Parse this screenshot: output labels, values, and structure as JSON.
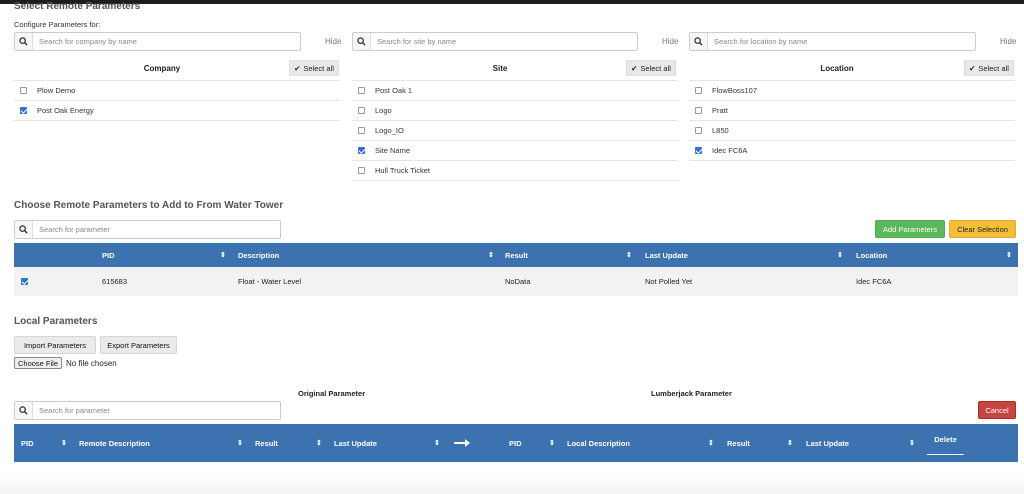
{
  "sections": {
    "select_remote": "Select Remote Parameters",
    "configure_for": "Configure Parameters for:",
    "choose_remote": "Choose Remote Parameters to Add to From Water Tower",
    "local_params": "Local Parameters"
  },
  "filters": {
    "company": {
      "placeholder": "Search for company by name",
      "hide": "Hide",
      "header": "Company",
      "select_all": "Select all",
      "items": [
        {
          "label": "Plow Demo",
          "checked": false
        },
        {
          "label": "Post Oak Energy",
          "checked": true
        }
      ]
    },
    "site": {
      "placeholder": "Search for site by name",
      "hide": "Hide",
      "header": "Site",
      "select_all": "Select all",
      "items": [
        {
          "label": "Post Oak 1",
          "checked": false
        },
        {
          "label": "Logo",
          "checked": false
        },
        {
          "label": "Logo_IO",
          "checked": false
        },
        {
          "label": "Site Name",
          "checked": true
        },
        {
          "label": "Hull Truck Ticket",
          "checked": false
        }
      ]
    },
    "location": {
      "placeholder": "Search for location by name",
      "hide": "Hide",
      "header": "Location",
      "select_all": "Select all",
      "items": [
        {
          "label": "FlowBoss107",
          "checked": false
        },
        {
          "label": "Pratt",
          "checked": false
        },
        {
          "label": "L850",
          "checked": false
        },
        {
          "label": "Idec FC6A",
          "checked": true
        }
      ]
    }
  },
  "remote_table": {
    "search_placeholder": "Search for parameter",
    "add_button": "Add Parameters",
    "clear_button": "Clear Selection",
    "columns": [
      "PID",
      "Description",
      "Result",
      "Last Update",
      "Location"
    ],
    "rows": [
      {
        "checked": true,
        "pid": "615683",
        "description": "Float - Water Level",
        "result": "NoData",
        "last_update": "Not Polled Yet",
        "location": "Idec FC6A"
      }
    ]
  },
  "local": {
    "import_button": "Import Parameters",
    "export_button": "Export Parameters",
    "choose_file": "Choose File",
    "no_file": "No file chosen",
    "original_header": "Original Parameter",
    "lumberjack_header": "Lumberjack Parameter",
    "search_placeholder": "Search for parameter",
    "cancel_button": "Cancel",
    "columns_original": [
      "PID",
      "Remote Description",
      "Result",
      "Last Update"
    ],
    "columns_lumberjack": [
      "PID",
      "Local Description",
      "Result",
      "Last Update"
    ],
    "delete_label": "Delete",
    "arrow_icon": "arrow-right-icon"
  },
  "colors": {
    "table_header": "#3d72b0",
    "green": "#5cb85c",
    "yellow": "#f2c037",
    "red": "#c4463f",
    "checkbox": "#2f6fd6"
  }
}
